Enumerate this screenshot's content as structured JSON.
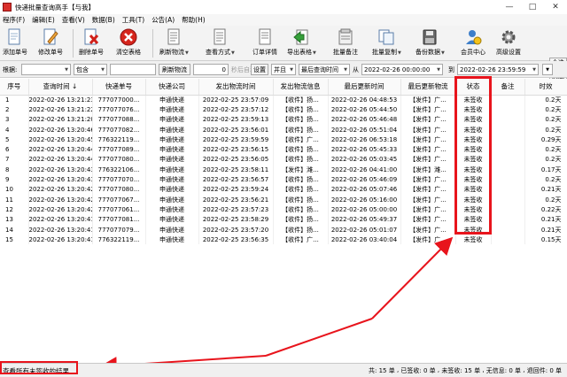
{
  "window": {
    "title": "快递批量查询高手【与我】",
    "controls": [
      "—",
      "□",
      "✕"
    ]
  },
  "menu": [
    "程序(F)",
    "编辑(E)",
    "查看(V)",
    "数据(B)",
    "工具(T)",
    "公告(A)",
    "帮助(H)"
  ],
  "toolbar": {
    "buttons": [
      {
        "label": "添加单号",
        "icon": "add-document-icon"
      },
      {
        "label": "修改单号",
        "icon": "edit-pencil-icon"
      },
      {
        "label": "删除单号",
        "icon": "delete-x-icon"
      },
      {
        "label": "清空表格",
        "icon": "clear-stop-icon"
      },
      {
        "label": "刷新物流",
        "icon": "refresh-logistics-icon",
        "dropdown": true
      },
      {
        "label": "查看方式",
        "icon": "view-mode-icon",
        "dropdown": true
      },
      {
        "label": "订单详情",
        "icon": "order-detail-icon"
      },
      {
        "label": "导出表格",
        "icon": "export-table-icon",
        "dropdown": true
      },
      {
        "label": "批量备注",
        "icon": "batch-note-icon"
      },
      {
        "label": "批量复制",
        "icon": "batch-copy-icon",
        "dropdown": true
      },
      {
        "label": "备份数据",
        "icon": "backup-icon",
        "dropdown": true
      },
      {
        "label": "会员中心",
        "icon": "member-center-icon"
      },
      {
        "label": "高级设置",
        "icon": "settings-gear-icon"
      }
    ],
    "side_buttons": [
      "全选",
      "反选"
    ]
  },
  "filter": {
    "root_label": "根据:",
    "root_value": "",
    "match_value": "包含",
    "search_value": "",
    "refresh_label": "刷新物流",
    "seconds_value": "0",
    "auto_refresh_label": "秒后自动刷新",
    "settings_label": "设置",
    "logic_value": "并且",
    "time_field_value": "最后查询时间",
    "from_label": "从",
    "from_value": "2022-02-26 00:00:00",
    "to_label": "到",
    "to_value": "2022-02-26 23:59:59"
  },
  "table": {
    "columns": [
      "序号",
      "查询时间 ↓",
      "快递单号",
      "快递公司",
      "发出物流时间",
      "发出物流信息",
      "最后更新时间",
      "最后更新物流",
      "状态",
      "备注",
      "时效"
    ],
    "rows": [
      [
        "1",
        "2022-02-26 13:21:23",
        "777077000...",
        "申通快递",
        "2022-02-25 23:57:09",
        "【收件】扬...",
        "2022-02-26 04:48:53",
        "【发件】广...",
        "未签收",
        "",
        "0.2天"
      ],
      [
        "2",
        "2022-02-26 13:21:22",
        "777077076...",
        "申通快递",
        "2022-02-25 23:57:12",
        "【收件】扬...",
        "2022-02-26 05:44:50",
        "【发件】广...",
        "未签收",
        "",
        "0.2天"
      ],
      [
        "3",
        "2022-02-26 13:21:20",
        "777077088...",
        "申通快递",
        "2022-02-25 23:59:13",
        "【收件】扬...",
        "2022-02-26 05:46:48",
        "【发件】广...",
        "未签收",
        "",
        "0.2天"
      ],
      [
        "4",
        "2022-02-26 13:20:46",
        "777077082...",
        "申通快递",
        "2022-02-25 23:56:01",
        "【收件】扬...",
        "2022-02-26 05:51:04",
        "【发件】广...",
        "未签收",
        "",
        "0.2天"
      ],
      [
        "5",
        "2022-02-26 13:20:45",
        "776322119...",
        "申通快递",
        "2022-02-25 23:59:59",
        "【收件】广...",
        "2022-02-26 06:53:18",
        "【发件】广...",
        "未签收",
        "",
        "0.29天"
      ],
      [
        "6",
        "2022-02-26 13:20:44",
        "777077089...",
        "申通快递",
        "2022-02-25 23:56:15",
        "【收件】扬...",
        "2022-02-26 05:45:33",
        "【发件】广...",
        "未签收",
        "",
        "0.2天"
      ],
      [
        "7",
        "2022-02-26 13:20:44",
        "777077080...",
        "申通快递",
        "2022-02-25 23:56:05",
        "【收件】扬...",
        "2022-02-26 05:03:45",
        "【发件】广...",
        "未签收",
        "",
        "0.2天"
      ],
      [
        "8",
        "2022-02-26 13:20:43",
        "776322106...",
        "申通快递",
        "2022-02-25 23:58:11",
        "【发件】潍...",
        "2022-02-26 04:41:00",
        "【发件】潍...",
        "未签收",
        "",
        "0.17天"
      ],
      [
        "9",
        "2022-02-26 13:20:43",
        "777077070...",
        "申通快递",
        "2022-02-25 23:56:57",
        "【收件】扬...",
        "2022-02-26 05:46:09",
        "【发件】广...",
        "未签收",
        "",
        "0.2天"
      ],
      [
        "10",
        "2022-02-26 13:20:42",
        "777077080...",
        "申通快递",
        "2022-02-25 23:59:24",
        "【收件】扬...",
        "2022-02-26 05:07:46",
        "【发件】广...",
        "未签收",
        "",
        "0.21天"
      ],
      [
        "11",
        "2022-02-26 13:20:42",
        "777077067...",
        "申通快递",
        "2022-02-25 23:56:21",
        "【收件】扬...",
        "2022-02-26 05:16:00",
        "【发件】广...",
        "未签收",
        "",
        "0.2天"
      ],
      [
        "12",
        "2022-02-26 13:20:42",
        "777077061...",
        "申通快递",
        "2022-02-25 23:57:23",
        "【收件】扬...",
        "2022-02-26 05:00:00",
        "【发件】广...",
        "未签收",
        "",
        "0.22天"
      ],
      [
        "13",
        "2022-02-26 13:20:41",
        "777077081...",
        "申通快递",
        "2022-02-25 23:58:29",
        "【收件】扬...",
        "2022-02-26 05:49:37",
        "【发件】广...",
        "未签收",
        "",
        "0.21天"
      ],
      [
        "14",
        "2022-02-26 13:20:41",
        "777077079...",
        "申通快递",
        "2022-02-25 23:57:20",
        "【收件】扬...",
        "2022-02-26 05:01:07",
        "【发件】广...",
        "未签收",
        "",
        "0.21天"
      ],
      [
        "15",
        "2022-02-26 13:20:41",
        "776322119...",
        "申通快递",
        "2022-02-25 23:56:35",
        "【收件】广...",
        "2022-02-26 03:40:04",
        "【发件】广...",
        "未签收",
        "",
        "0.15天"
      ]
    ]
  },
  "status": {
    "left": "查看所有未签收的结果",
    "right": [
      "共: 15 单",
      "已签收: 0 单",
      "未签收: 15 单",
      "无信息: 0 单",
      "退回件: 0 单"
    ],
    "sep": " , "
  },
  "colors": {
    "annotation_red": "#e8141c",
    "toolbar_bg": "#f3f3f3"
  }
}
